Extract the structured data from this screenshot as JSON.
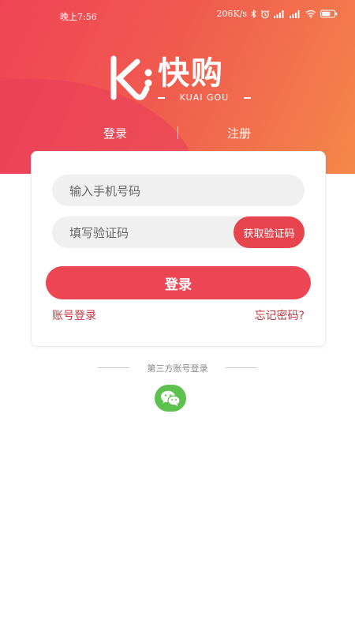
{
  "status_bar": {
    "time": "晚上7:56",
    "network_speed": "206K/s",
    "icons": [
      "bluetooth-icon",
      "alarm-icon",
      "signal-icon",
      "signal-icon",
      "wifi-icon",
      "battery-icon"
    ]
  },
  "logo": {
    "text": "快购",
    "subtitle": "KUAI GOU"
  },
  "tabs": {
    "login": "登录",
    "register": "注册"
  },
  "form": {
    "phone_placeholder": "输入手机号码",
    "code_placeholder": "填写验证码",
    "get_code_label": "获取验证码",
    "login_label": "登录",
    "account_login_link": "账号登录",
    "forgot_password_link": "忘记密码?"
  },
  "third_party": {
    "label": "第三方账号登录",
    "provider_icon": "wechat-icon"
  },
  "colors": {
    "primary": "#ec4654",
    "gradient_start": "#ef4455",
    "gradient_end": "#f4884a",
    "wechat": "#5cc14d",
    "link": "#c8353f"
  }
}
